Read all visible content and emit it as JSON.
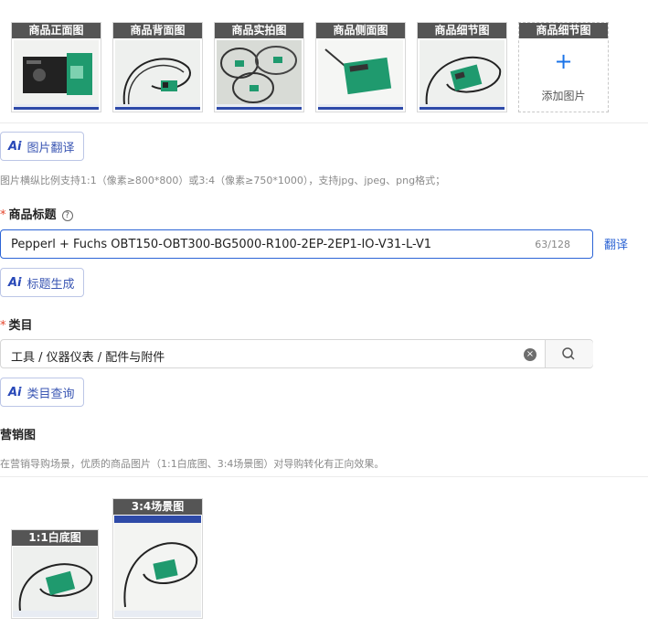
{
  "product_images": [
    {
      "label": "商品正面图",
      "icon": "sensor-front-photo"
    },
    {
      "label": "商品背面图",
      "icon": "sensor-back-photo"
    },
    {
      "label": "商品实拍图",
      "icon": "packaged-sensors-photo"
    },
    {
      "label": "商品侧面图",
      "icon": "sensor-side-photo"
    },
    {
      "label": "商品细节图",
      "icon": "sensor-detail-photo"
    }
  ],
  "add_slot": {
    "label": "商品细节图",
    "add_label": "添加图片",
    "icon": "plus-icon"
  },
  "image_translate_button": "图片翻译",
  "ai_badge": "Ai",
  "image_hint": "图片横纵比例支持1:1（像素≥800*800）或3:4（像素≥750*1000），支持jpg、jpeg、png格式；",
  "title_field": {
    "required_mark": "*",
    "label": "商品标题",
    "help_icon": "?",
    "value": "Pepperl + Fuchs OBT150-OBT300-BG5000-R100-2EP-2EP1-IO-V31-L-V1",
    "count": "63/128",
    "translate_link": "翻译"
  },
  "title_generate_button": "标题生成",
  "category_field": {
    "required_mark": "*",
    "label": "类目",
    "value": "工具 / 仪器仪表 / 配件与附件",
    "clear_icon": "×"
  },
  "category_query_button": "类目查询",
  "marketing": {
    "label": "营销图",
    "hint": "在营销导购场景，优质的商品图片（1:1白底图、3:4场景图）对导购转化有正向效果。",
    "images": [
      {
        "label": "1:1白底图"
      },
      {
        "label": "3:4场景图"
      }
    ]
  },
  "colors": {
    "accent": "#2d64d4",
    "required": "#e5452c",
    "caption_bg": "#555555",
    "sensor_green": "#1f9a6e"
  }
}
